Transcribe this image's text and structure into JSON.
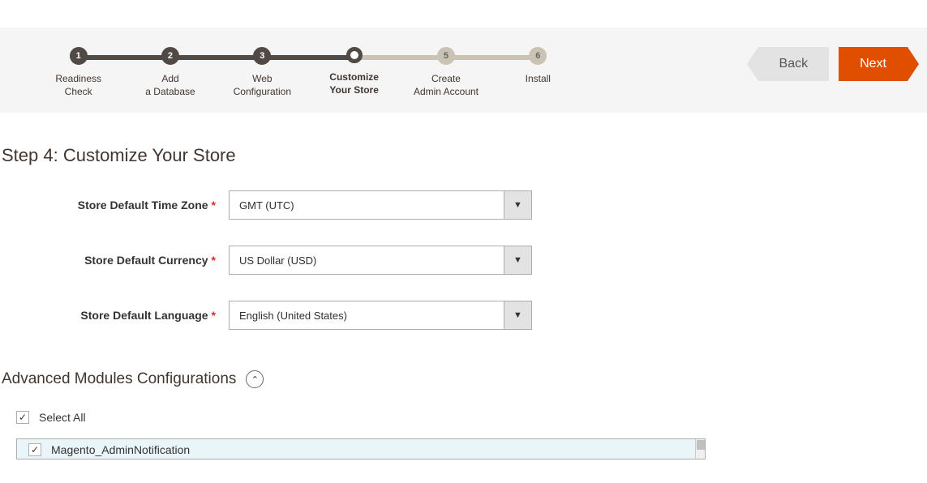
{
  "nav": {
    "back": "Back",
    "next": "Next"
  },
  "steps": {
    "s1": {
      "num": "1",
      "label": "Readiness\nCheck"
    },
    "s2": {
      "num": "2",
      "label": "Add\na Database"
    },
    "s3": {
      "num": "3",
      "label": "Web\nConfiguration"
    },
    "s4": {
      "num": "",
      "label": "Customize\nYour Store"
    },
    "s5": {
      "num": "5",
      "label": "Create\nAdmin Account"
    },
    "s6": {
      "num": "6",
      "label": "Install"
    }
  },
  "page_title": "Step 4: Customize Your Store",
  "form": {
    "timezone": {
      "label": "Store Default Time Zone",
      "value": "GMT (UTC)"
    },
    "currency": {
      "label": "Store Default Currency",
      "value": "US Dollar (USD)"
    },
    "language": {
      "label": "Store Default Language",
      "value": "English (United States)"
    }
  },
  "advanced": {
    "heading": "Advanced Modules Configurations",
    "select_all": "Select All",
    "modules": {
      "m1": "Magento_AdminNotification"
    }
  },
  "required_marker": "*"
}
